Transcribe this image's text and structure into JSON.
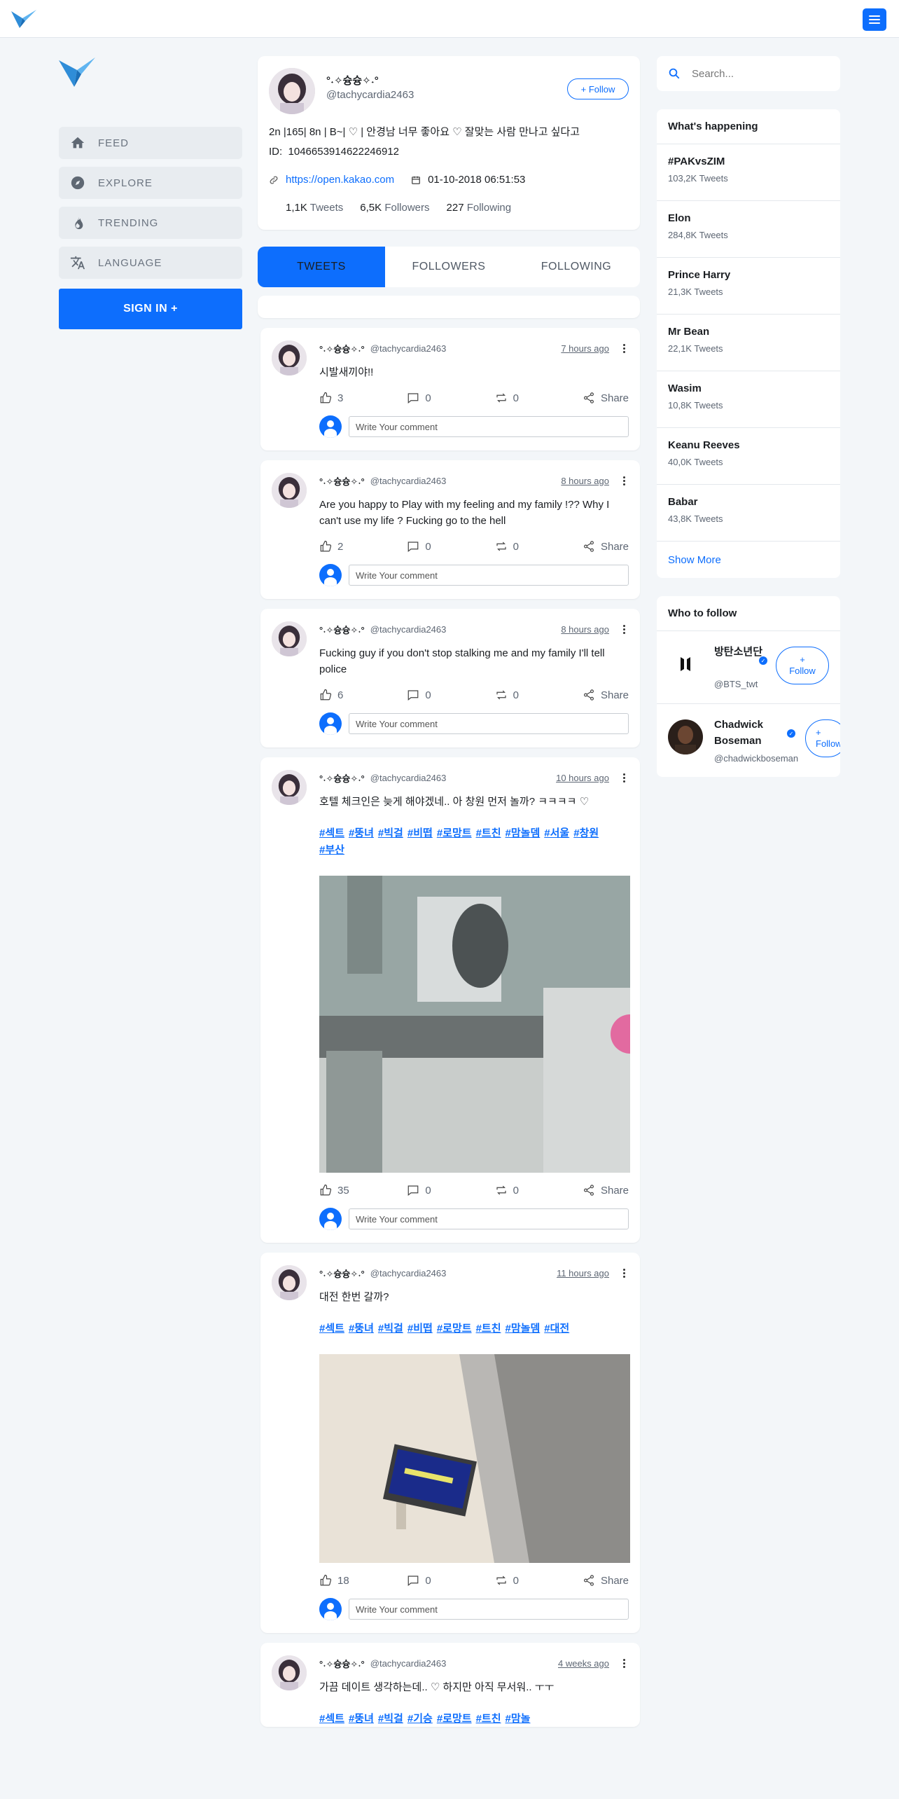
{
  "nav": {
    "items": [
      {
        "label": "FEED",
        "icon": "home-icon"
      },
      {
        "label": "EXPLORE",
        "icon": "compass-icon"
      },
      {
        "label": "TRENDING",
        "icon": "flame-icon"
      },
      {
        "label": "LANGUAGE",
        "icon": "translate-icon"
      }
    ],
    "signin_label": "SIGN IN +"
  },
  "profile": {
    "name": "°˖✧슝슝✧˖°",
    "handle": "@tachycardia2463",
    "follow_label": "+ Follow",
    "bio": "2n |165| 8n | B~| ♡ | 안경남 너무 좋아요 ♡ 잘맞는 사람 만나고 싶다고",
    "id_label": "ID:",
    "id": "1046653914622246912",
    "link": "https://open.kakao.com",
    "joined": "01-10-2018 06:51:53",
    "stats": {
      "tweets_count": "1,1K",
      "tweets_label": "Tweets",
      "followers_count": "6,5K",
      "followers_label": "Followers",
      "following_count": "227",
      "following_label": "Following"
    }
  },
  "tabs": [
    "TWEETS",
    "FOLLOWERS",
    "FOLLOWING"
  ],
  "tweets": [
    {
      "name": "°˖✧슝슝✧˖°",
      "handle": "@tachycardia2463",
      "time": "7 hours ago",
      "text": "시발새끼야!!",
      "tags": [],
      "likes": "3",
      "comments": "0",
      "retweets": "0",
      "share": "Share",
      "comment_placeholder": "Write Your comment"
    },
    {
      "name": "°˖✧슝슝✧˖°",
      "handle": "@tachycardia2463",
      "time": "8 hours ago",
      "text": "Are you happy to Play with my feeling and my family !?? Why I can't use my life ? Fucking go to the hell",
      "tags": [],
      "likes": "2",
      "comments": "0",
      "retweets": "0",
      "share": "Share",
      "comment_placeholder": "Write Your comment"
    },
    {
      "name": "°˖✧슝슝✧˖°",
      "handle": "@tachycardia2463",
      "time": "8 hours ago",
      "text": "Fucking guy if you don't stop stalking me and my family I'll tell police",
      "tags": [],
      "likes": "6",
      "comments": "0",
      "retweets": "0",
      "share": "Share",
      "comment_placeholder": "Write Your comment"
    },
    {
      "name": "°˖✧슝슝✧˖°",
      "handle": "@tachycardia2463",
      "time": "10 hours ago",
      "text": "호텔 체크인은 늦게 해야겠네.. 아 창원 먼저 놀까? ㅋㅋㅋㅋ ♡",
      "tags": [
        "#섹트",
        "#뚱녀",
        "#빅걸",
        "#비떱",
        "#로망트",
        "#트친",
        "#맘놀뎀",
        "#서울",
        "#창원",
        "#부산"
      ],
      "likes": "35",
      "comments": "0",
      "retweets": "0",
      "share": "Share",
      "comment_placeholder": "Write Your comment"
    },
    {
      "name": "°˖✧슝슝✧˖°",
      "handle": "@tachycardia2463",
      "time": "11 hours ago",
      "text": "대전 한번 갈까?",
      "tags": [
        "#섹트",
        "#뚱녀",
        "#빅걸",
        "#비떱",
        "#로망트",
        "#트친",
        "#맘놀뎀",
        "#대전"
      ],
      "likes": "18",
      "comments": "0",
      "retweets": "0",
      "share": "Share",
      "comment_placeholder": "Write Your comment"
    },
    {
      "name": "°˖✧슝슝✧˖°",
      "handle": "@tachycardia2463",
      "time": "4 weeks ago",
      "text": "가끔 데이트 생각하는데.. ♡ 하지만 아직 무서워.. ㅜㅜ",
      "tags": [
        "#섹트",
        "#뚱녀",
        "#빅걸",
        "#기승",
        "#로망트",
        "#트친",
        "#맘놀"
      ]
    }
  ],
  "search": {
    "placeholder": "Search..."
  },
  "trends": {
    "title": "What's happening",
    "items": [
      {
        "name": "#PAKvsZIM",
        "count": "103,2K Tweets"
      },
      {
        "name": "Elon",
        "count": "284,8K Tweets"
      },
      {
        "name": "Prince Harry",
        "count": "21,3K Tweets"
      },
      {
        "name": "Mr Bean",
        "count": "22,1K Tweets"
      },
      {
        "name": "Wasim",
        "count": "10,8K Tweets"
      },
      {
        "name": "Keanu Reeves",
        "count": "40,0K Tweets"
      },
      {
        "name": "Babar",
        "count": "43,8K Tweets"
      }
    ],
    "show_more": "Show More"
  },
  "who_to_follow": {
    "title": "Who to follow",
    "items": [
      {
        "name": "방탄소년단",
        "handle": "@BTS_twt",
        "follow_plus": "+",
        "follow_label": "Follow"
      },
      {
        "name": "Chadwick Boseman",
        "handle": "@chadwickboseman",
        "follow_plus": "+",
        "follow_label": "Follow"
      }
    ]
  },
  "colors": {
    "accent": "#0d6efd",
    "background": "#f3f6f9",
    "card": "#ffffff"
  }
}
